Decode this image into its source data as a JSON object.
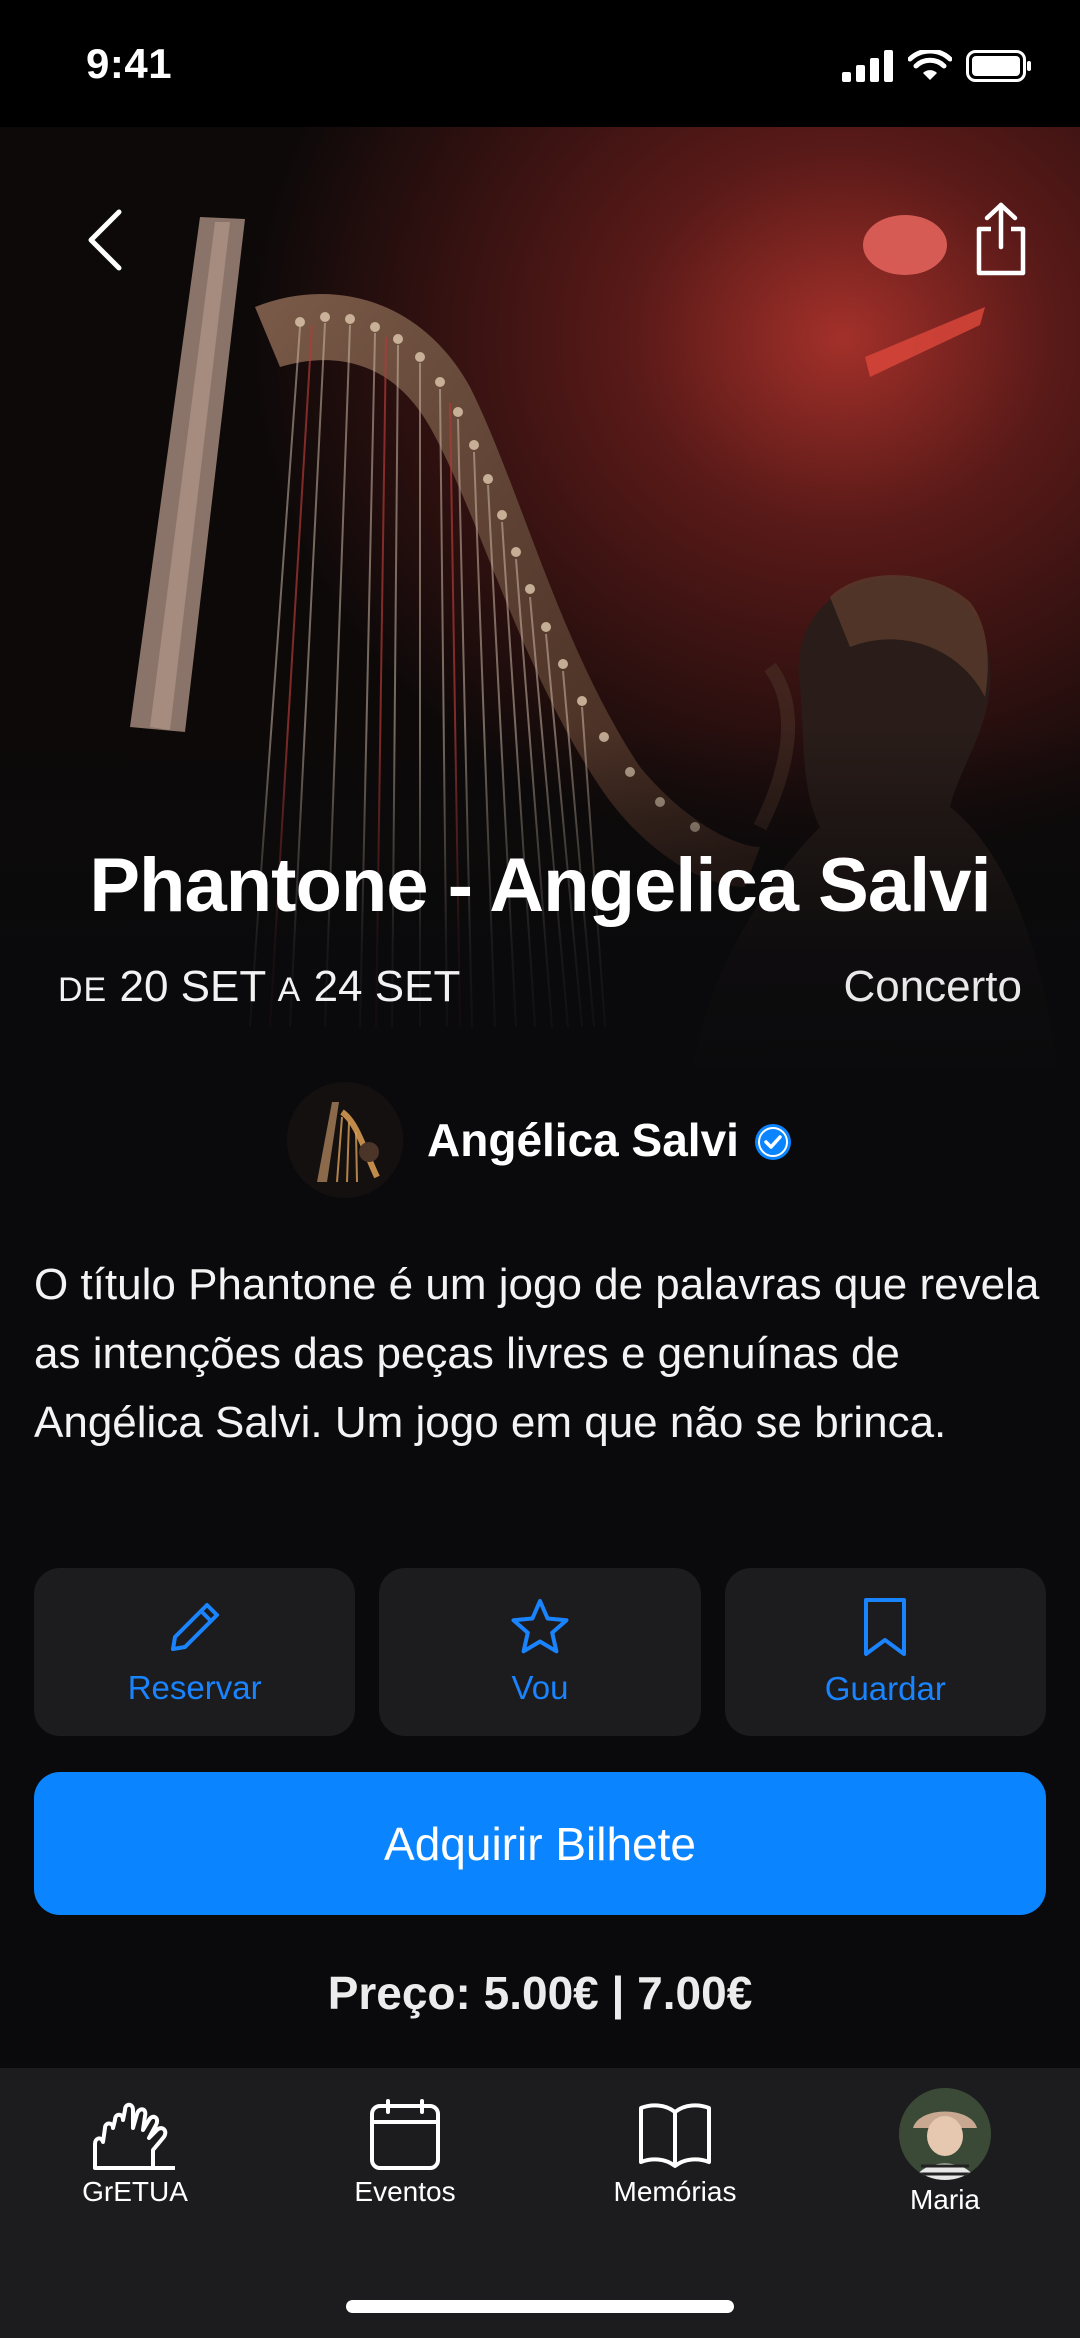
{
  "status_bar": {
    "time": "9:41"
  },
  "hero": {
    "back_icon": "chevron-left-icon",
    "share_icon": "share-icon"
  },
  "event": {
    "title": "Phantone - Angelica Salvi",
    "dates": {
      "from_word": "DE",
      "start": "20 SET",
      "to_word": "A",
      "end": "24 SET"
    },
    "category": "Concerto"
  },
  "artist": {
    "name": "Angélica Salvi",
    "verified_icon": "verified-badge-icon"
  },
  "description": "O título Phantone é um jogo de palavras que revela as intenções das peças livres e genuínas de Angélica Salvi. Um jogo em que não se brinca.",
  "actions": [
    {
      "label": "Reservar",
      "icon": "pencil-icon"
    },
    {
      "label": "Vou",
      "icon": "star-icon"
    },
    {
      "label": "Guardar",
      "icon": "bookmark-icon"
    }
  ],
  "buy_button": {
    "label": "Adquirir Bilhete"
  },
  "price": "Preço: 5.00€ | 7.00€",
  "tab_bar": {
    "tabs": [
      {
        "label": "GrETUA",
        "icon": "hands-icon"
      },
      {
        "label": "Eventos",
        "icon": "calendar-icon"
      },
      {
        "label": "Memórias",
        "icon": "book-icon"
      },
      {
        "label": "Maria",
        "icon": "profile-avatar"
      }
    ]
  },
  "colors": {
    "accent": "#0a84ff",
    "background": "#0a0a0c",
    "card": "#1c1c1f",
    "tab_bar": "#1c1c1e"
  }
}
